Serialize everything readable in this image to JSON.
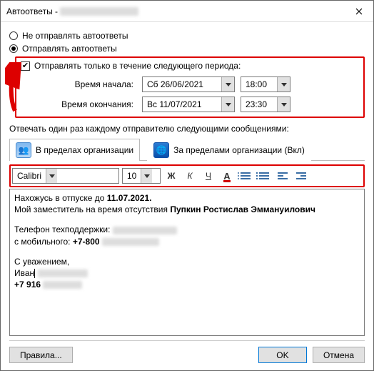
{
  "window": {
    "title_prefix": "Автоответы - "
  },
  "radios": {
    "no_send": "Не отправлять автоответы",
    "send": "Отправлять автоответы"
  },
  "period": {
    "checkbox_label": "Отправлять только в течение следующего периода:",
    "start_label": "Время начала:",
    "end_label": "Время окончания:",
    "start_date": "Сб 26/06/2021",
    "start_time": "18:00",
    "end_date": "Вс 11/07/2021",
    "end_time": "23:30"
  },
  "reply_label": "Отвечать один раз каждому отправителю следующими сообщениями:",
  "tabs": {
    "inside": "В пределах организации",
    "outside": "За пределами организации (Вкл)"
  },
  "format": {
    "font": "Calibri",
    "size": "10",
    "bold": "Ж",
    "italic": "К",
    "underline": "Ч",
    "font_color": "А"
  },
  "message": {
    "line1_a": "Нахожусь в отпуске до ",
    "line1_b": "11.07.2021.",
    "line2_a": "Мой заместитель на время отсутствия ",
    "line2_b": "Пупкин Ростислав Эммануилович",
    "line3": "Телефон техподдержки:",
    "line4_a": "с мобильного: ",
    "line4_b": "+7-800",
    "line5": "С уважением,",
    "line6": "Иван",
    "line7": "+7 916"
  },
  "buttons": {
    "rules": "Правила...",
    "ok": "OK",
    "cancel": "Отмена"
  }
}
